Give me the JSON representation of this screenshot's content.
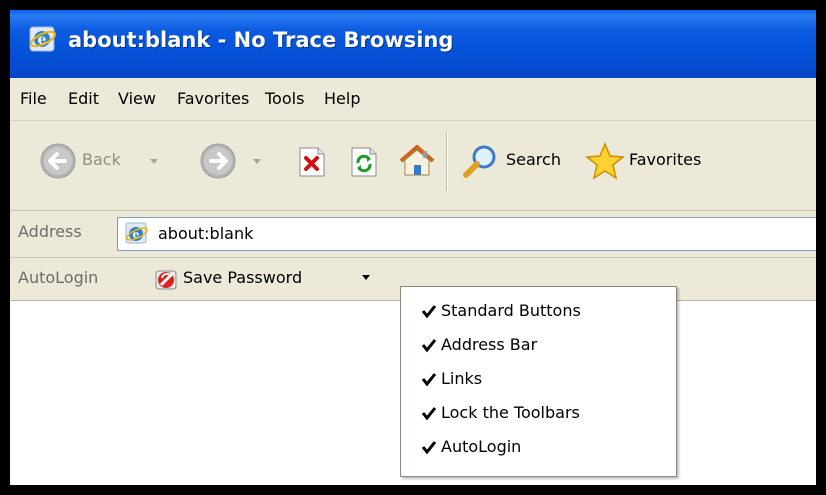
{
  "window": {
    "title": "about:blank - No Trace Browsing"
  },
  "menubar": {
    "items": [
      "File",
      "Edit",
      "View",
      "Favorites",
      "Tools",
      "Help"
    ]
  },
  "toolbar": {
    "back_label": "Back",
    "search_label": "Search",
    "favorites_label": "Favorites",
    "icons": [
      "back-icon",
      "forward-icon",
      "stop-icon",
      "refresh-icon",
      "home-icon",
      "search-icon",
      "favorites-star-icon"
    ]
  },
  "address": {
    "label": "Address",
    "value": "about:blank"
  },
  "autologin": {
    "label": "AutoLogin",
    "save_password": "Save Password"
  },
  "context_menu": {
    "items": [
      {
        "label": "Standard Buttons",
        "checked": true
      },
      {
        "label": "Address Bar",
        "checked": true
      },
      {
        "label": "Links",
        "checked": true
      },
      {
        "label": "Lock the Toolbars",
        "checked": true
      },
      {
        "label": "AutoLogin",
        "checked": true
      }
    ]
  },
  "colors": {
    "titlebar": "#0552da",
    "chrome": "#ece9d8",
    "menu_bg": "#ffffff"
  }
}
